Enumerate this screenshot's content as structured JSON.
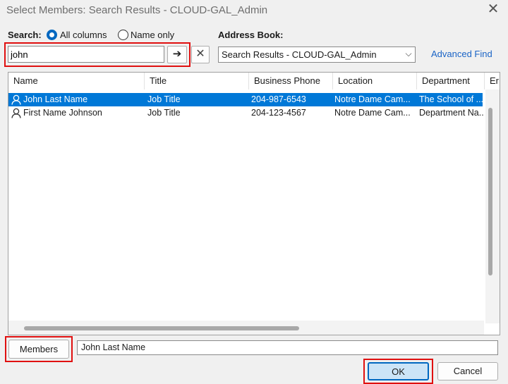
{
  "window": {
    "title": "Select Members: Search Results - CLOUD-GAL_Admin",
    "close_glyph": "✕"
  },
  "search": {
    "label": "Search:",
    "option_all": "All columns",
    "option_name": "Name only",
    "selected_option": "All columns",
    "value": "john",
    "go_glyph": "➔",
    "clear_glyph": "✕"
  },
  "address_book": {
    "label": "Address Book:",
    "selected": "Search Results - CLOUD-GAL_Admin",
    "chevron": "⌵",
    "advanced_find": "Advanced Find"
  },
  "table": {
    "columns": [
      "Name",
      "Title",
      "Business Phone",
      "Location",
      "Department",
      "Er"
    ],
    "rows": [
      {
        "name": "John Last Name",
        "title": "Job Title",
        "phone": "204-987-6543",
        "location": "Notre Dame Cam...",
        "department": "The School of ...",
        "selected": true
      },
      {
        "name": "First Name Johnson",
        "title": "Job Title",
        "phone": "204-123-4567",
        "location": "Notre Dame Cam...",
        "department": "Department Na...",
        "selected": false
      }
    ]
  },
  "members": {
    "button_label": "Members",
    "value": "John Last Name"
  },
  "footer": {
    "ok_label": "OK",
    "cancel_label": "Cancel"
  },
  "colors": {
    "accent": "#0067c0",
    "selection": "#0078d7",
    "highlight_box": "#e01010",
    "link": "#1a64c6"
  }
}
